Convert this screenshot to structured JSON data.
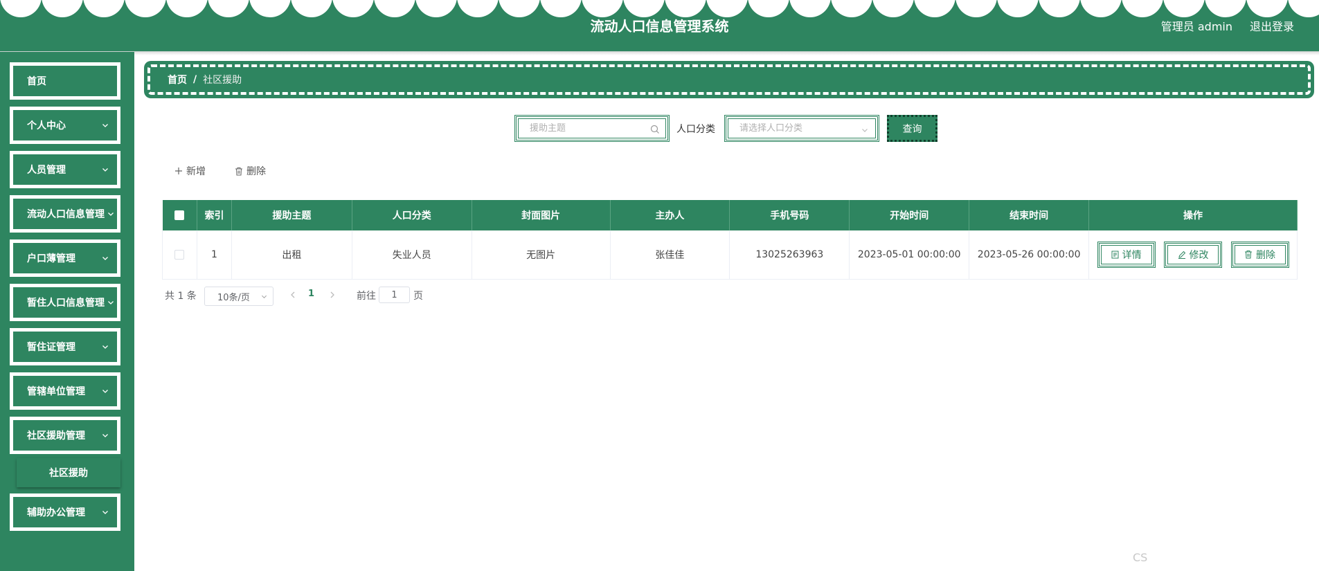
{
  "header": {
    "title": "流动人口信息管理系统",
    "user": "管理员 admin",
    "logout": "退出登录",
    "color": "#2e8560"
  },
  "sidebar": {
    "items": [
      {
        "label": "首页"
      },
      {
        "label": "个人中心"
      },
      {
        "label": "人员管理"
      },
      {
        "label": "流动人口信息管理"
      },
      {
        "label": "户口薄管理"
      },
      {
        "label": "暂住人口信息管理"
      },
      {
        "label": "暂住证管理"
      },
      {
        "label": "管辖单位管理"
      },
      {
        "label": "社区援助管理"
      },
      {
        "label": "辅助办公管理"
      }
    ],
    "submenu": {
      "label": "社区援助"
    }
  },
  "breadcrumb": {
    "home": "首页",
    "separator": "/",
    "current": "社区援助"
  },
  "search": {
    "placeholder": "援助主题",
    "filter_label": "人口分类",
    "select_placeholder": "请选择人口分类",
    "query_button": "查询"
  },
  "toolbar": {
    "add": "新增",
    "delete": "删除"
  },
  "table": {
    "columns": [
      "索引",
      "援助主题",
      "人口分类",
      "封面图片",
      "主办人",
      "手机号码",
      "开始时间",
      "结束时间",
      "操作"
    ],
    "rows": [
      {
        "index": "1",
        "topic": "出租",
        "category": "失业人员",
        "cover": "无图片",
        "organizer": "张佳佳",
        "phone": "13025263963",
        "start": "2023-05-01 00:00:00",
        "end": "2023-05-26 00:00:00"
      }
    ],
    "actions": {
      "detail": "详情",
      "edit": "修改",
      "delete": "删除"
    }
  },
  "pagination": {
    "total": "共 1 条",
    "page_size": "10条/页",
    "current_page": "1",
    "goto_label": "前往",
    "goto_value": "1",
    "page_unit": "页"
  },
  "watermark": "CS"
}
